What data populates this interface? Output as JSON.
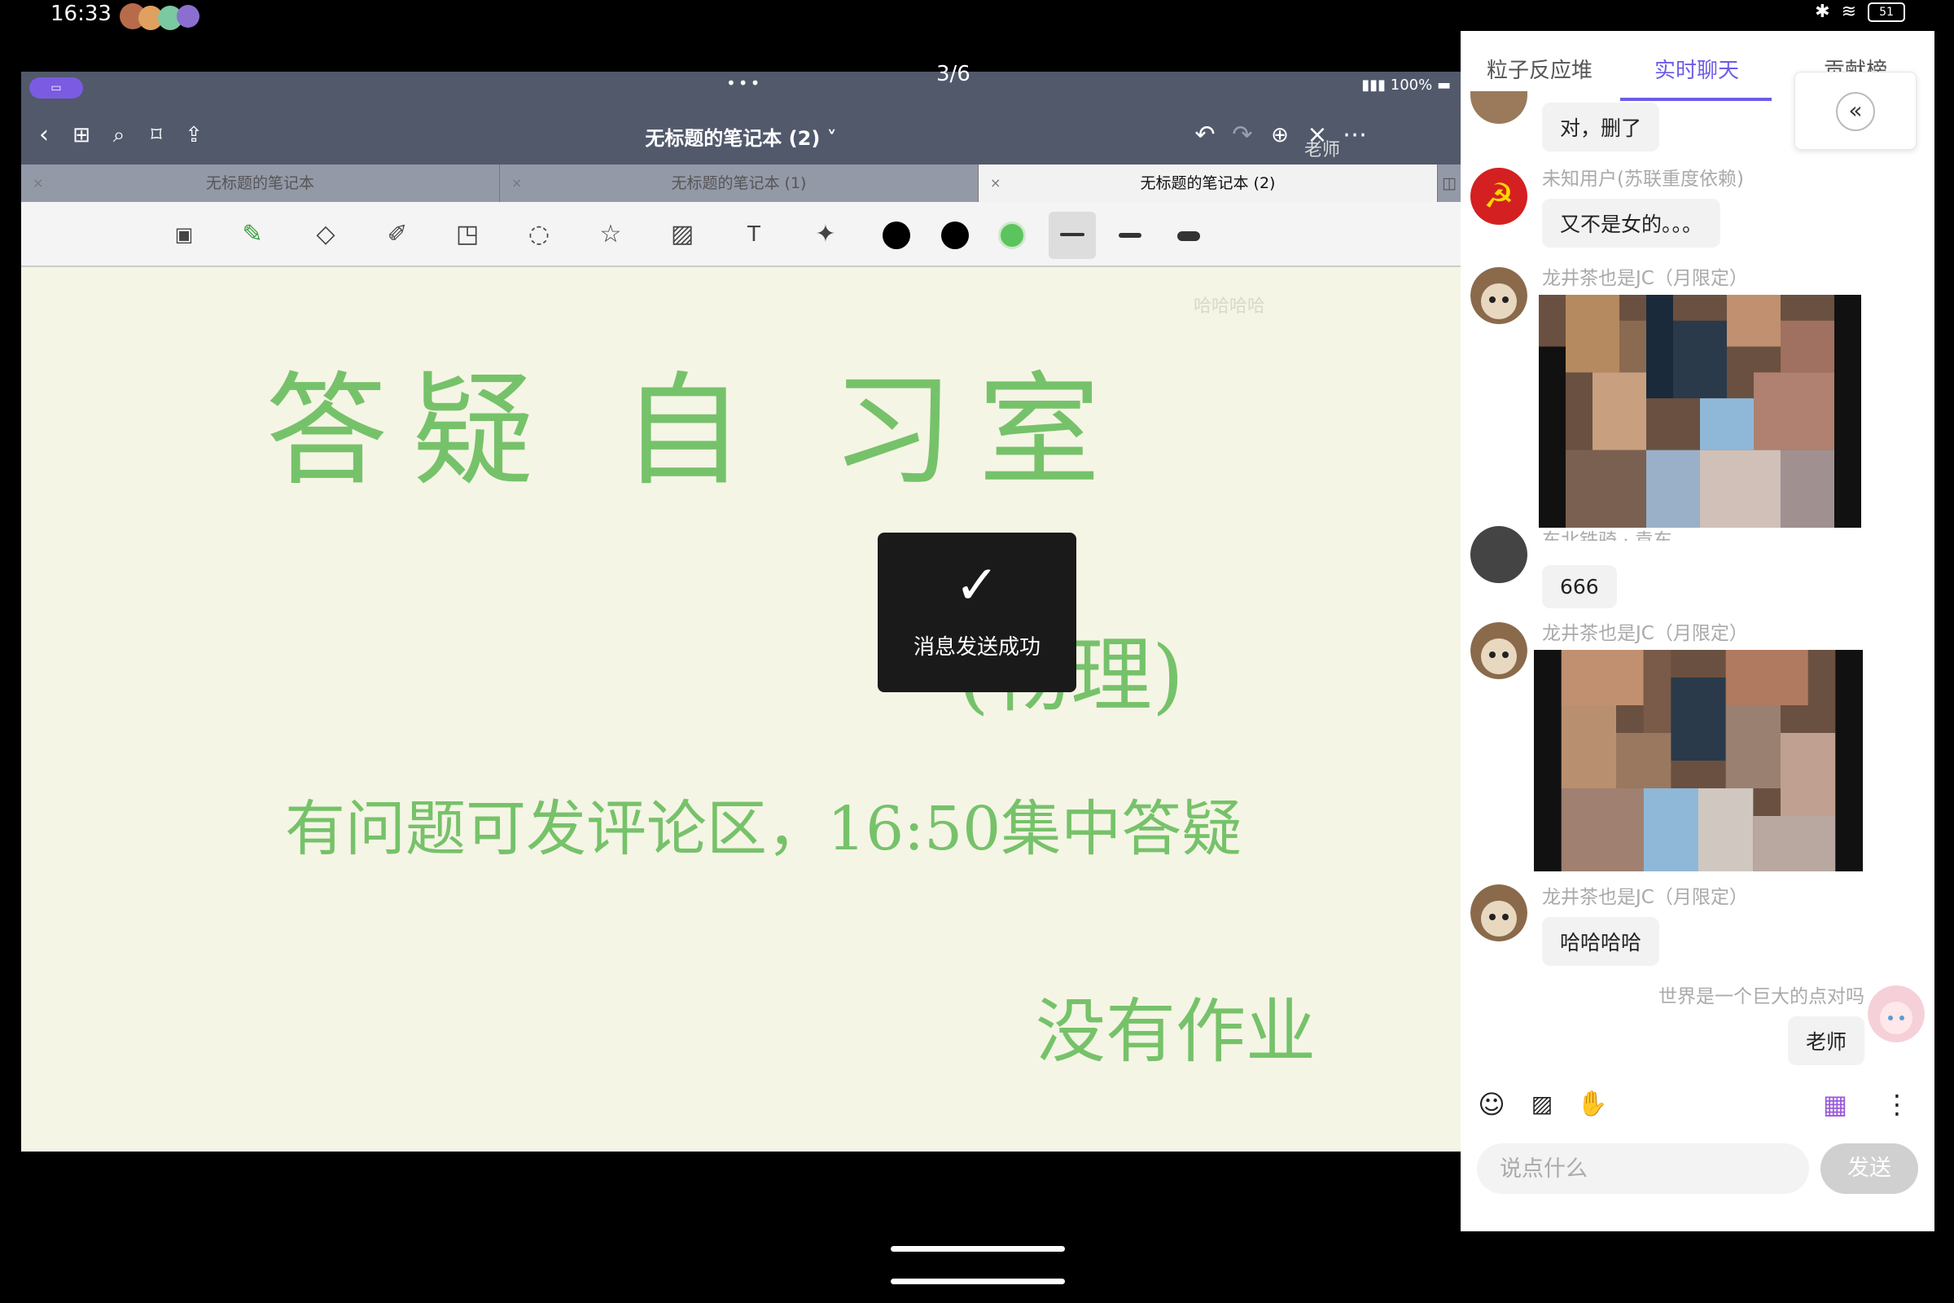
{
  "status_bar": {
    "time": "16:33",
    "battery": "51"
  },
  "share": {
    "page_counter": "3/6",
    "device_battery": "100%",
    "teacher_label": "老师",
    "note_title": "无标题的笔记本 (2)",
    "tabs": [
      {
        "label": "无标题的笔记本"
      },
      {
        "label": "无标题的笔记本 (1)"
      },
      {
        "label": "无标题的笔记本 (2)"
      }
    ],
    "canvas_ghost": "哈哈哈哈",
    "ink": {
      "title": "答疑 自 习室",
      "subject": "(物理)",
      "line1": "有问题可发评论区，16:50集中答疑",
      "line2": "没有作业"
    },
    "ink_color": "#76c26a"
  },
  "toast": {
    "text": "消息发送成功"
  },
  "chat": {
    "tabs": [
      "粒子反应堆",
      "实时聊天",
      "贡献榜"
    ],
    "active_tab": "实时聊天",
    "accent": "#6c5ce7",
    "messages": [
      {
        "user": "",
        "text": "对，删了"
      },
      {
        "user": "未知用户(苏联重度依赖)",
        "text": "又不是女的。。。"
      },
      {
        "user": "龙井茶也是JC（月限定）",
        "text": ""
      },
      {
        "user": "东北铁骑 · 袁东",
        "text": "666"
      },
      {
        "user": "龙井茶也是JC（月限定）",
        "text": ""
      },
      {
        "user": "龙井茶也是JC（月限定）",
        "text": "哈哈哈哈"
      },
      {
        "user": "世界是一个巨大的点对吗",
        "text": "老师"
      }
    ],
    "input_placeholder": "说点什么",
    "send_label": "发送"
  }
}
